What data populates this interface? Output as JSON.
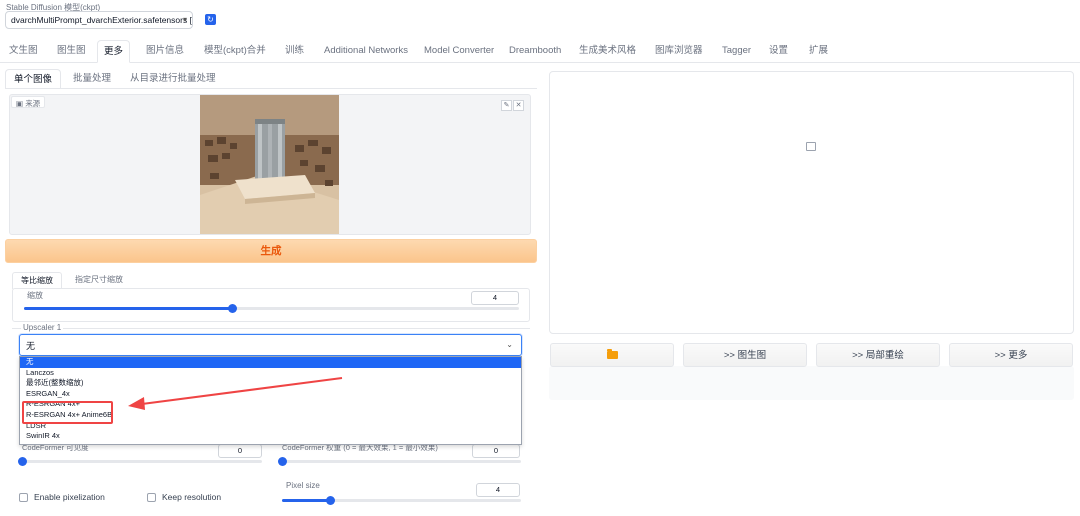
{
  "model": {
    "label": "Stable Diffusion 模型(ckpt)",
    "value": "dvarchMultiPrompt_dvarchExterior.safetensors ["
  },
  "tabs": [
    "文生图",
    "图生图",
    "更多",
    "图片信息",
    "模型(ckpt)合并",
    "训练",
    "Additional Networks",
    "Model Converter",
    "Dreambooth",
    "生成美术风格",
    "图库浏览器",
    "Tagger",
    "设置",
    "扩展"
  ],
  "subtabs": [
    "单个图像",
    "批量处理",
    "从目录进行批量处理"
  ],
  "source_label": "来源",
  "generate_label": "生成",
  "resize_tabs": [
    "等比缩放",
    "指定尺寸缩放"
  ],
  "scale": {
    "label": "缩放",
    "value": "4",
    "fraction": 0.42
  },
  "upscaler": {
    "label": "Upscaler 1",
    "selected": "无",
    "options": [
      "无",
      "Lanczos",
      "最邻近(整数缩放)",
      "ESRGAN_4x",
      "R-ESRGAN 4x+",
      "R-ESRGAN 4x+ Anime6B",
      "LDSR",
      "SwinIR 4x"
    ]
  },
  "codeformer": {
    "visibility_label": "CodeFormer 可见度",
    "visibility_value": "0",
    "weight_label": "CodeFormer 权重 (0 = 最大效果, 1 = 最小效果)",
    "weight_value": "0"
  },
  "pixelization": {
    "label": "Enable pixelization"
  },
  "keep_resolution": {
    "label": "Keep resolution"
  },
  "pixel_size": {
    "label": "Pixel size",
    "value": "4",
    "fraction": 0.2
  },
  "action_buttons": [
    ">> 图生图",
    ">> 局部重绘",
    ">> 更多"
  ],
  "colors": {
    "accent": "#2563eb",
    "generate": "#ea580c",
    "highlight": "#ef4444"
  }
}
